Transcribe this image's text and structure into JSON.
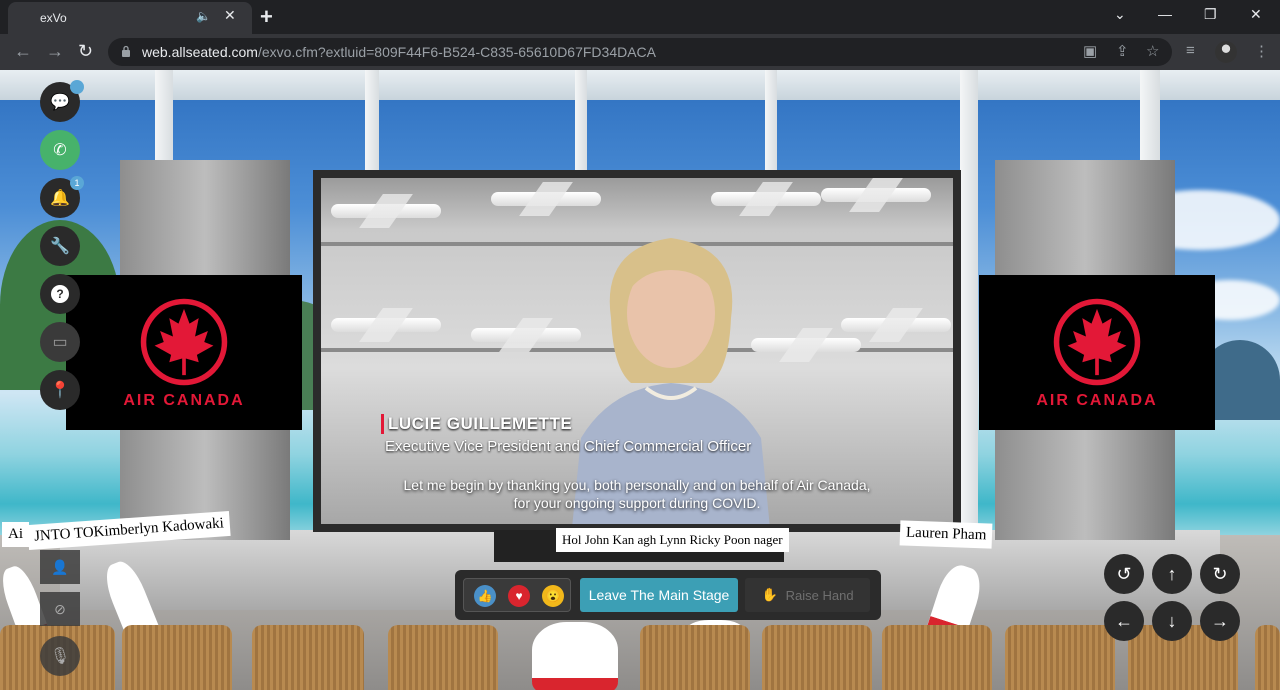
{
  "browser": {
    "tab_title": "exVo",
    "tab_audio_icon": "speaker-icon",
    "tab_close": "✕",
    "new_tab": "+",
    "url_host": "web.allseated.com",
    "url_path": "/exvo.cfm?extluid=809F44F6-B524-C835-65610D67FD34DACA",
    "window_controls": [
      "⌄",
      "—",
      "❐",
      "✕"
    ]
  },
  "sidebar": {
    "chat_badge": "",
    "notifications_badge": "1"
  },
  "stage": {
    "logo_text": "AIR CANADA",
    "speaker_name": "LUCIE GUILLEMETTE",
    "speaker_title": "Executive Vice President and Chief Commercial Officer",
    "caption_line1": "Let me begin by thanking you, both personally and on behalf of Air Canada,",
    "caption_line2": "for your ongoing support during COVID."
  },
  "nametags": {
    "t1": "Ai",
    "t2": "JNTO TOKimberlyn Kadowaki",
    "t3": "Hol John Kan agh  Lynn Ricky Poon nager",
    "t4": "Lauren Pham"
  },
  "controls": {
    "leave_label": "Leave The Main Stage",
    "raise_label": "Raise Hand"
  },
  "colors": {
    "accent": "#3c9fb5",
    "brand_red": "#e31837",
    "call_green": "#47b26b"
  }
}
